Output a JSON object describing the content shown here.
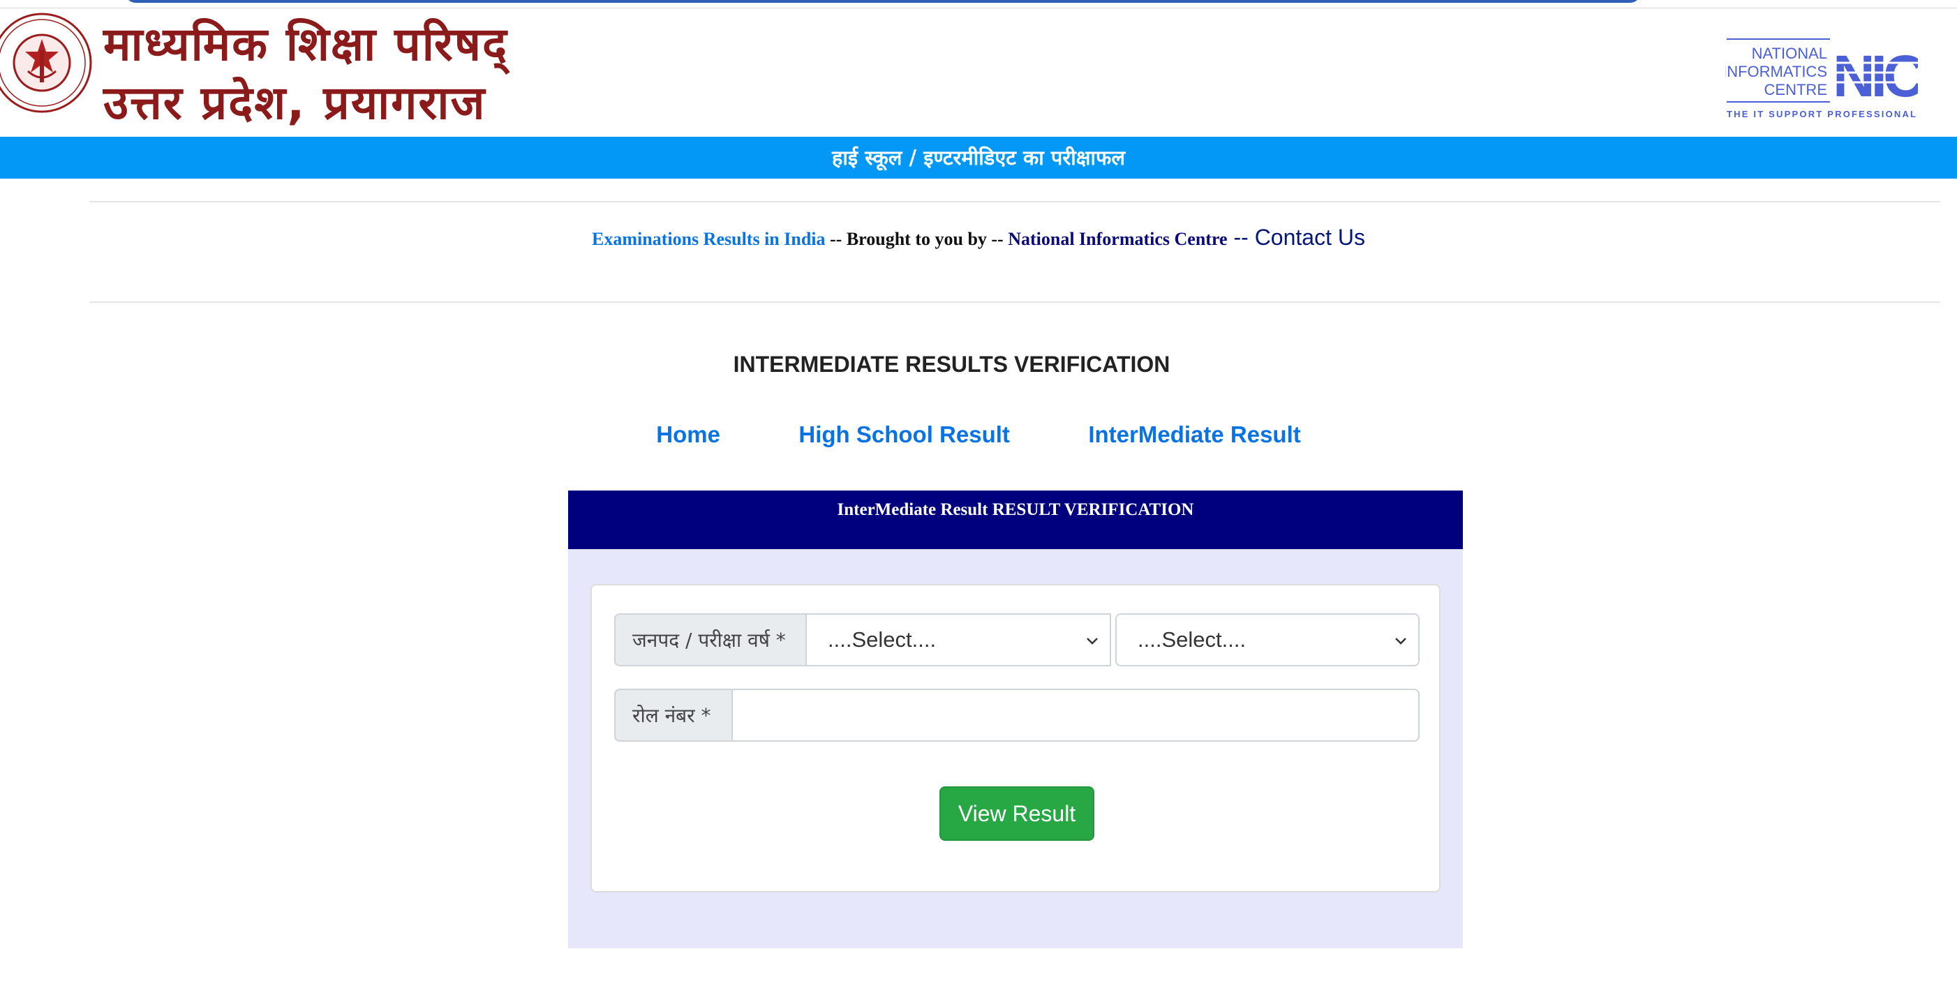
{
  "header": {
    "board_title_line1": "माध्यमिक शिक्षा परिषद्",
    "board_title_line2": "उत्तर प्रदेश, प्रयागराज",
    "emblem_text": "माध्यमिक शिक्षा परिषद्  उत्तर प्रदेश",
    "nic_logo": {
      "line1": "NATIONAL",
      "line2": "INFORMATICS",
      "line3": "CENTRE",
      "mark": "NIC",
      "tagline": "THE IT SUPPORT PROFESSIONALS"
    }
  },
  "band": {
    "title": "हाई स्कूल / इण्टरमीडिएट का परीक्षाफल"
  },
  "credit": {
    "link_india": "Examinations Results in India",
    "brought_by": " -- Brought to you by -- ",
    "link_nic": "National Informatics Centre",
    "separator": " -- ",
    "contact": "Contact Us"
  },
  "page_heading": "INTERMEDIATE RESULTS VERIFICATION",
  "nav": {
    "home": "Home",
    "high_school": "High School Result",
    "intermediate": "InterMediate Result"
  },
  "panel": {
    "title": "InterMediate Result RESULT VERIFICATION",
    "district_year_label": "जनपद / परीक्षा वर्ष *",
    "district_select_value": "....Select....",
    "year_select_value": "....Select....",
    "roll_label": "रोल नंबर *",
    "roll_value": "",
    "submit_label": "View Result"
  },
  "colors": {
    "brand_maroon": "#8b1a1a",
    "band_blue": "#0398f6",
    "panel_navy": "#00007f",
    "panel_bg": "#e7e7fb",
    "link_blue": "#0a73e3",
    "button_green": "#28a745",
    "nic_blue": "#4b5fd6"
  }
}
